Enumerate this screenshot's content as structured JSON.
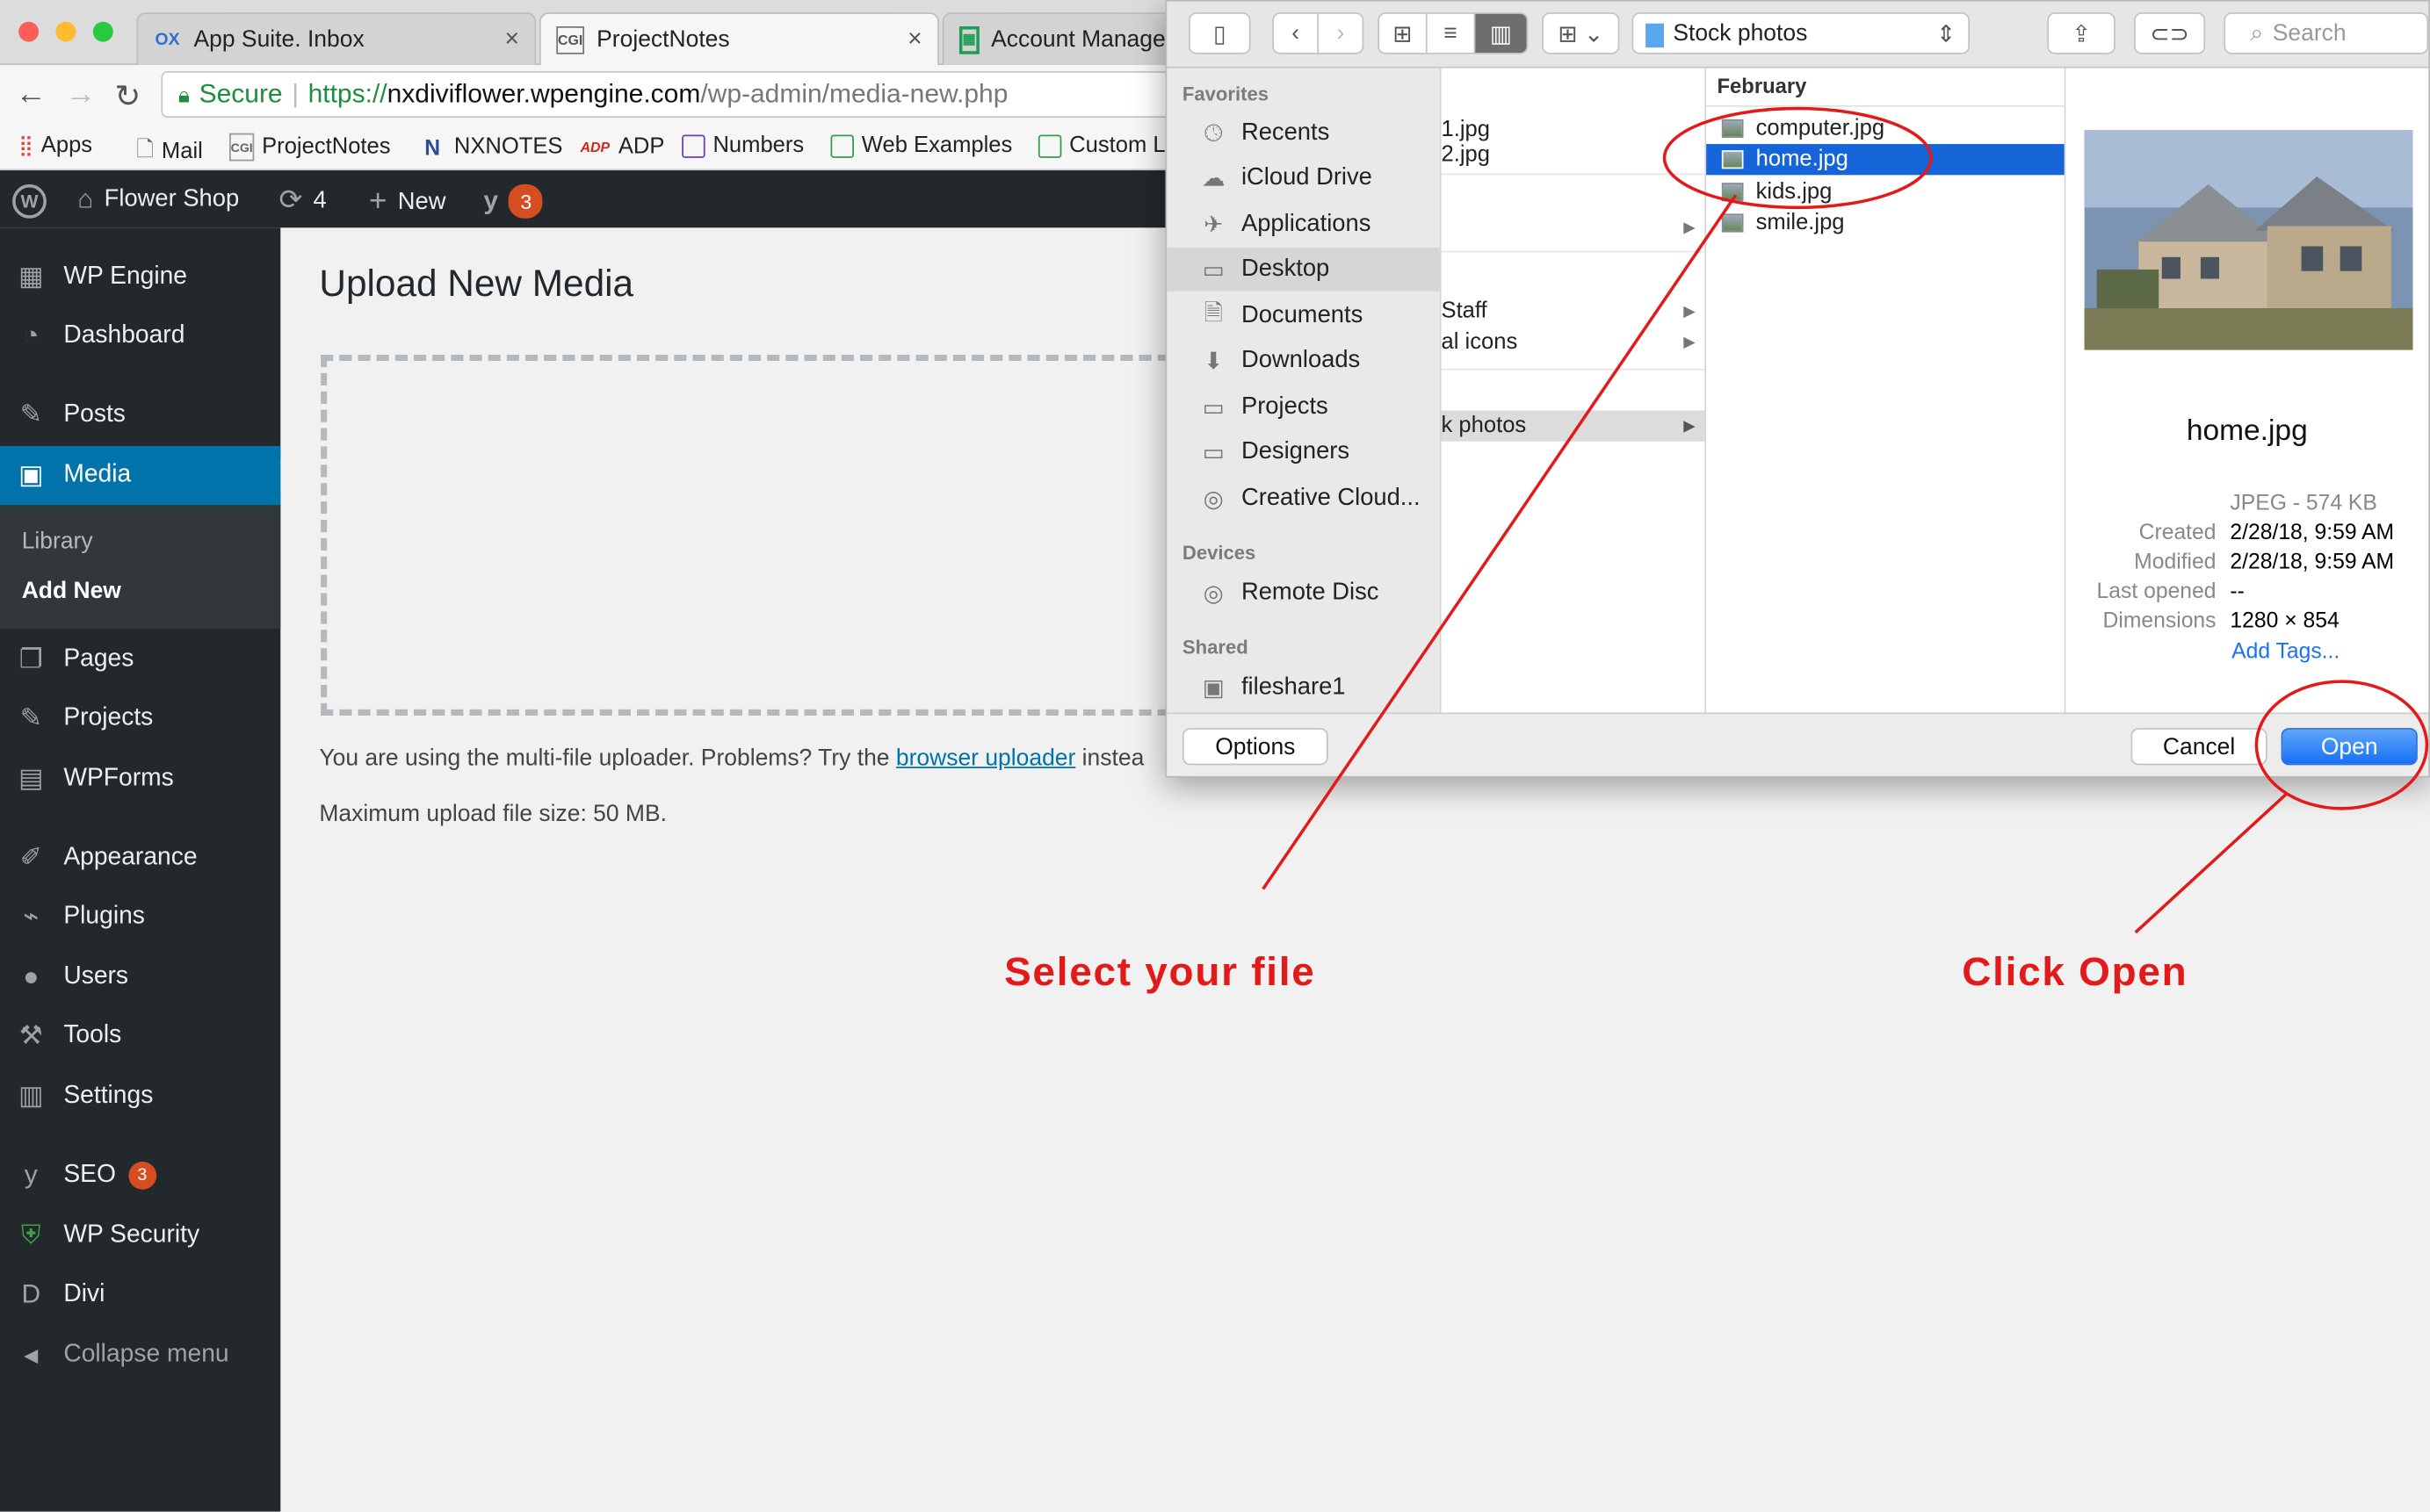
{
  "browser": {
    "tabs": [
      {
        "label": "App Suite. Inbox",
        "icon": "ox"
      },
      {
        "label": "ProjectNotes",
        "icon": "cgi"
      },
      {
        "label": "Account Manager",
        "icon": "sheet"
      }
    ],
    "url": {
      "secure_label": "Secure",
      "scheme": "https://",
      "host": "nxdiviflower.wpengine.com",
      "path": "/wp-admin/media-new.php"
    },
    "bookmarks": [
      "Apps",
      "Mail",
      "ProjectNotes",
      "NXNOTES",
      "ADP",
      "Numbers",
      "Web Examples",
      "Custom L"
    ],
    "bookmark_icons": {
      "cgi": "CGI",
      "nx": "N",
      "adp": "ADP"
    }
  },
  "adminbar": {
    "site_name": "Flower Shop",
    "updates_count": "4",
    "new_label": "New",
    "yoast_badge": "3"
  },
  "sidebar": {
    "items": [
      {
        "label": "WP Engine",
        "icon": "grid-icon"
      },
      {
        "label": "Dashboard",
        "icon": "gauge-icon"
      },
      {
        "label": "Posts",
        "icon": "pin-icon"
      },
      {
        "label": "Media",
        "icon": "media-icon"
      },
      {
        "label": "Pages",
        "icon": "pages-icon"
      },
      {
        "label": "Projects",
        "icon": "pin-icon"
      },
      {
        "label": "WPForms",
        "icon": "form-icon"
      },
      {
        "label": "Appearance",
        "icon": "brush-icon"
      },
      {
        "label": "Plugins",
        "icon": "plug-icon"
      },
      {
        "label": "Users",
        "icon": "user-icon"
      },
      {
        "label": "Tools",
        "icon": "wrench-icon"
      },
      {
        "label": "Settings",
        "icon": "settings-icon"
      },
      {
        "label": "SEO",
        "icon": "yoast-icon"
      },
      {
        "label": "WP Security",
        "icon": "shield-icon"
      },
      {
        "label": "Divi",
        "icon": "divi-icon"
      },
      {
        "label": "Collapse menu",
        "icon": "collapse-icon"
      }
    ],
    "seo_badge": "3",
    "submenu": {
      "library": "Library",
      "add_new": "Add New"
    }
  },
  "content": {
    "title": "Upload New Media",
    "uploader_text": "You are using the multi-file uploader. Problems? Try the ",
    "uploader_link": "browser uploader",
    "uploader_tail": " instea",
    "max_size": "Maximum upload file size: 50 MB."
  },
  "dialog": {
    "location": "Stock photos",
    "search_placeholder": "Search",
    "favorites_header": "Favorites",
    "favorites": [
      "Recents",
      "iCloud Drive",
      "Applications",
      "Desktop",
      "Documents",
      "Downloads",
      "Projects",
      "Designers",
      "Creative Cloud..."
    ],
    "devices_header": "Devices",
    "devices": [
      "Remote Disc"
    ],
    "shared_header": "Shared",
    "shared": [
      "fileshare1"
    ],
    "col1_items": [
      "1.jpg",
      "2.jpg",
      "Staff",
      "al icons",
      "k photos"
    ],
    "col2_header": "February",
    "col2_files": [
      "computer.jpg",
      "home.jpg",
      "kids.jpg",
      "smile.jpg"
    ],
    "preview": {
      "filename": "home.jpg",
      "kind": "JPEG - 574 KB",
      "created_label": "Created",
      "created": "2/28/18, 9:59 AM",
      "modified_label": "Modified",
      "modified": "2/28/18, 9:59 AM",
      "last_opened_label": "Last opened",
      "last_opened": "--",
      "dimensions_label": "Dimensions",
      "dimensions": "1280 × 854",
      "add_tags": "Add Tags..."
    },
    "options_label": "Options",
    "cancel_label": "Cancel",
    "open_label": "Open"
  },
  "annotations": {
    "select_file": "Select your file",
    "click_open": "Click Open",
    "color": "#e31a1a"
  }
}
